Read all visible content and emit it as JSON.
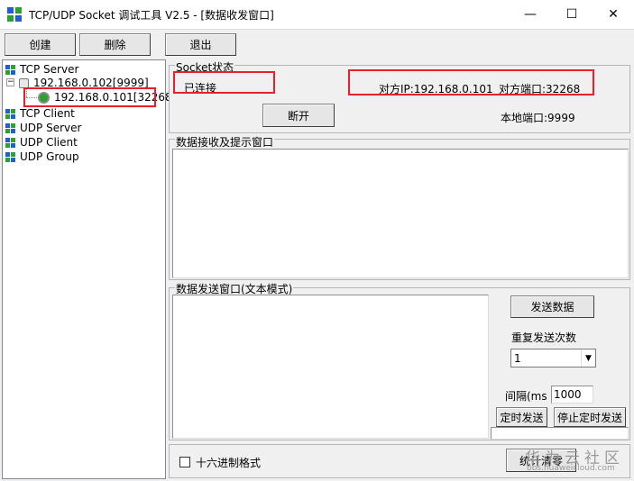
{
  "window": {
    "title": "TCP/UDP Socket 调试工具 V2.5 - [数据收发窗口]",
    "minimize": "—",
    "maximize": "☐",
    "close": "✕"
  },
  "toolbar": {
    "create_label": "创建",
    "delete_label": "删除",
    "exit_label": "退出"
  },
  "tree": {
    "tcp_server": "TCP Server",
    "server_addr": "192.168.0.102[9999]",
    "client_conn": "192.168.0.101[32268]",
    "tcp_client": "TCP Client",
    "udp_server": "UDP Server",
    "udp_client": "UDP Client",
    "udp_group": "UDP Group"
  },
  "socket_status": {
    "group_label": "Socket状态",
    "status": "已连接",
    "remote_ip": "对方IP:192.168.0.101",
    "remote_port": "对方端口:32268",
    "disconnect_label": "断开",
    "local_port": "本地端口:9999"
  },
  "receive": {
    "group_label": "数据接收及提示窗口"
  },
  "send": {
    "group_label": "数据发送窗口(文本模式)",
    "send_button": "发送数据",
    "repeat_label": "重复发送次数",
    "repeat_value": "1",
    "interval_label": "间隔(ms",
    "interval_value": "1000",
    "timer_send": "定时发送",
    "stop_timer_send": "停止定时发送"
  },
  "footer": {
    "hex_format": "十六进制格式",
    "clear_stats": "统计清零"
  },
  "watermark": {
    "brand": "华为云社区",
    "url": "bbs.huaweicloud.com"
  },
  "colors": {
    "highlight_red": "#e8202a",
    "icon_blue": "#1f5fd0",
    "icon_green": "#2aa32a"
  }
}
